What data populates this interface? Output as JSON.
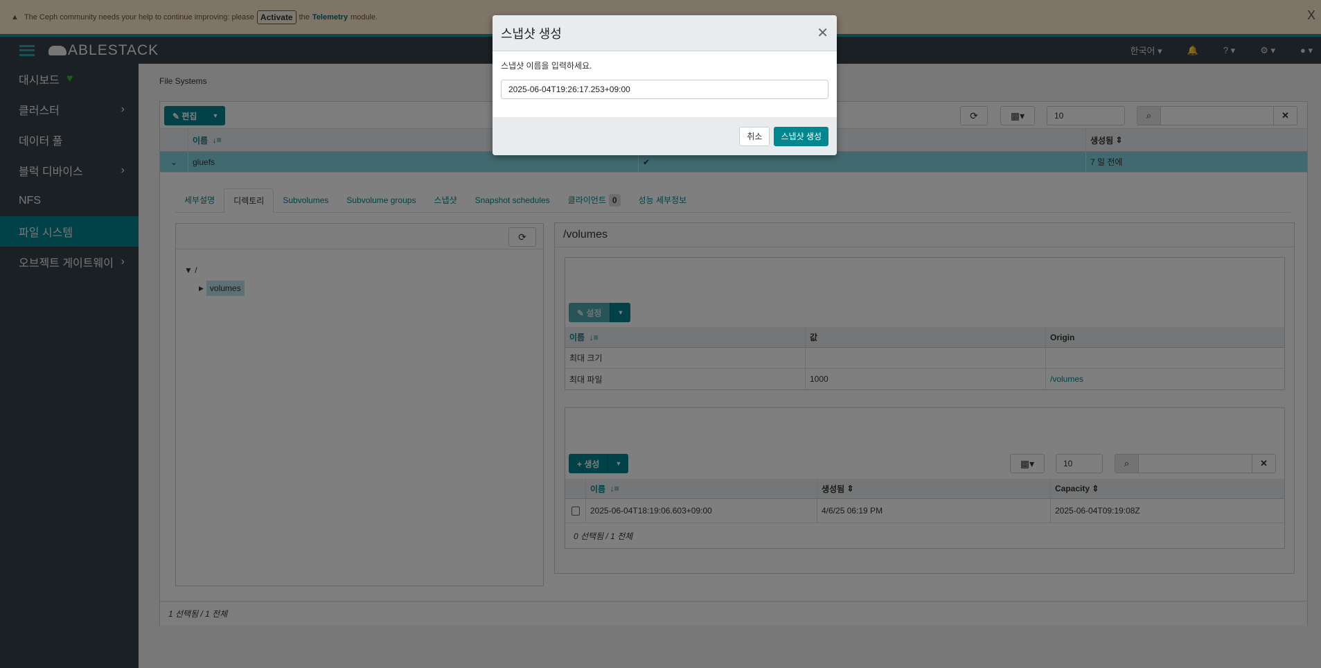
{
  "banner": {
    "text": "The Ceph community needs your help to continue improving: please",
    "activate": "Activate",
    "the": "the",
    "telemetry": "Telemetry",
    "module": "module.",
    "close": "X"
  },
  "nav": {
    "brand": "ABLESTACK",
    "language": "한국어 ▾",
    "help": "? ▾",
    "settings": "⚙ ▾",
    "user": "● ▾"
  },
  "sidebar": {
    "items": [
      {
        "label": "대시보드"
      },
      {
        "label": "클러스터"
      },
      {
        "label": "데이터 풀"
      },
      {
        "label": "블럭 디바이스"
      },
      {
        "label": "NFS"
      },
      {
        "label": "파일 시스템"
      },
      {
        "label": "오브젝트 게이트웨이"
      }
    ]
  },
  "breadcrumb": "File Systems",
  "fs_table": {
    "edit": "편집",
    "page_size": "10",
    "headers": [
      "이름",
      "",
      "생성됨"
    ],
    "sort_icon": "↓≡",
    "row": {
      "name": "gluefs",
      "enabled": "✔",
      "created": "7 일 전에"
    },
    "footer": "1 선택됨 / 1 전체"
  },
  "tabs": [
    {
      "label": "세부설명"
    },
    {
      "label": "디렉토리"
    },
    {
      "label": "Subvolumes"
    },
    {
      "label": "Subvolume groups"
    },
    {
      "label": "스냅샷"
    },
    {
      "label": "Snapshot schedules"
    },
    {
      "label": "클라이언트",
      "badge": "0"
    },
    {
      "label": "성능 세부정보"
    }
  ],
  "tree": {
    "root": "/",
    "child": "volumes"
  },
  "dir": {
    "title": "/volumes",
    "quota": {
      "set": "설정",
      "headers": [
        "이름",
        "값",
        "Origin"
      ],
      "rows": [
        {
          "name": "최대 크기",
          "value": "",
          "origin": ""
        },
        {
          "name": "최대 파일",
          "value": "1000",
          "origin": "/volumes"
        }
      ]
    },
    "snapshots": {
      "create": "생성",
      "page_size": "10",
      "headers": [
        "이름",
        "생성됨",
        "Capacity"
      ],
      "rows": [
        {
          "name": "2025-06-04T18:19:06.603+09:00",
          "created": "4/6/25 06:19 PM",
          "capacity": "2025-06-04T09:19:08Z"
        }
      ],
      "footer": "0 선택됨 / 1 전체"
    }
  },
  "modal": {
    "title": "스냅샷 생성",
    "prompt": "스냅샷 이름을 입력하세요.",
    "value": "2025-06-04T19:26:17.253+09:00",
    "cancel": "취소",
    "submit": "스냅샷 생성"
  }
}
